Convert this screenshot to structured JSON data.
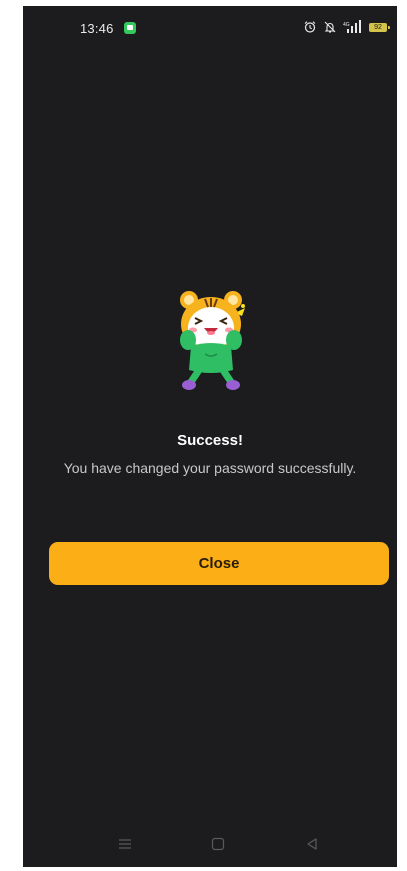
{
  "status_bar": {
    "time": "13:46",
    "battery_level": "92",
    "icons": [
      "message-app-icon",
      "alarm-icon",
      "silent-icon",
      "signal-icon",
      "battery-icon"
    ]
  },
  "dialog": {
    "illustration": "cheering-tiger-mascot",
    "title": "Success!",
    "message": "You have changed your password successfully.",
    "close_label": "Close"
  },
  "nav_bar": {
    "buttons": [
      "menu-icon",
      "home-icon",
      "back-icon"
    ]
  },
  "colors": {
    "background": "#1c1c1e",
    "accent": "#fbae16",
    "title_text": "#ffffff",
    "body_text": "#c8c8c8"
  }
}
